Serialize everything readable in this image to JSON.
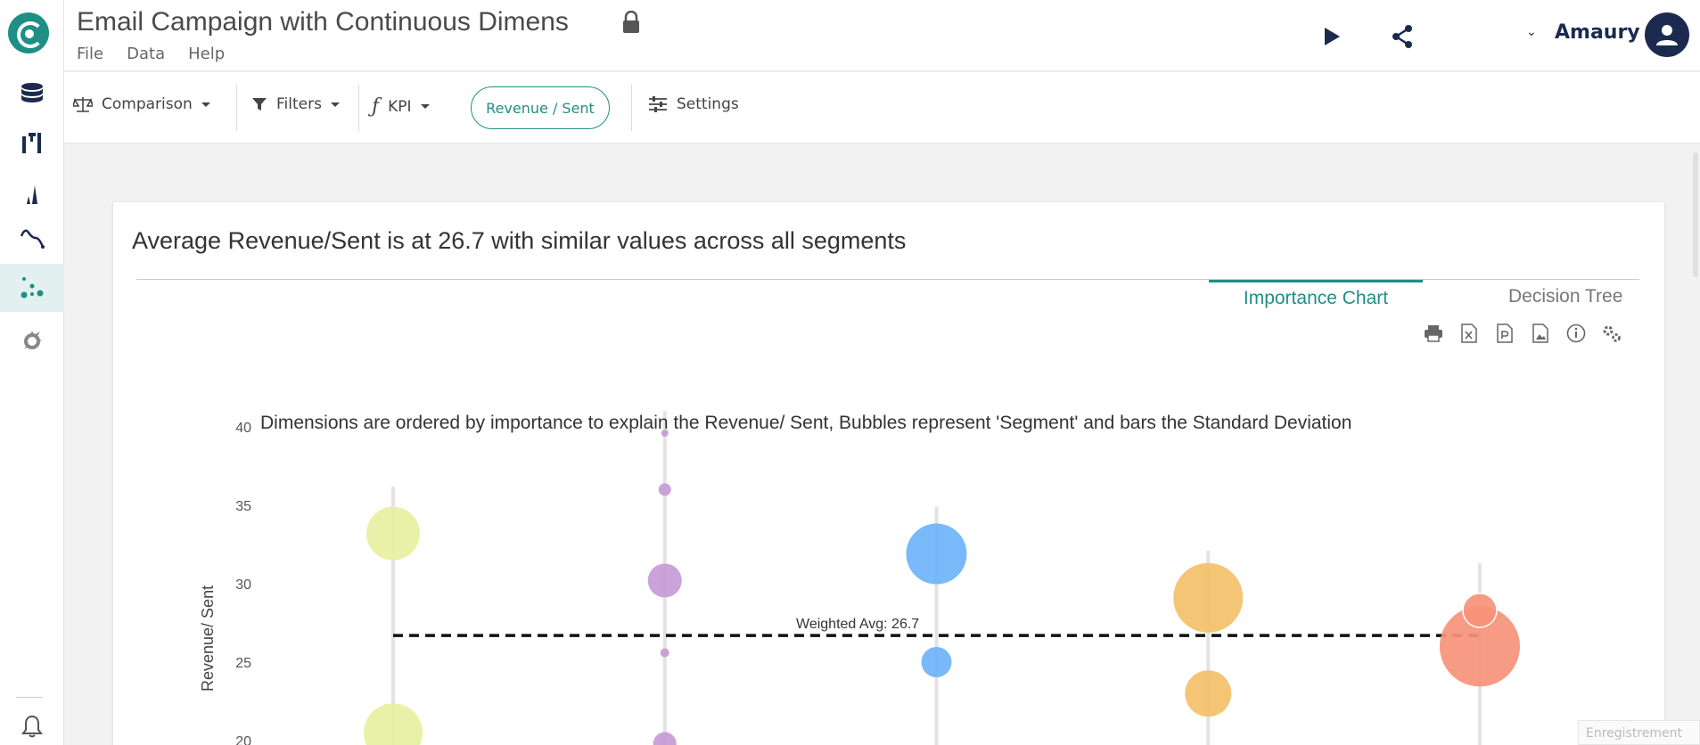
{
  "app": {
    "title": "Email Campaign with Continuous Dimens",
    "menu": [
      "File",
      "Data",
      "Help"
    ],
    "user": "Amaury"
  },
  "rail": {
    "items": [
      "database-icon",
      "columns-icon",
      "distribution-icon",
      "trend-icon",
      "segments-icon",
      "settings-cog-icon"
    ],
    "active": "segments-icon",
    "bottom": "bell-icon"
  },
  "toolbar": {
    "comparison": "Comparison",
    "filters": "Filters",
    "kpi": "KPI",
    "kpi_value": "Revenue / Sent",
    "settings": "Settings"
  },
  "card": {
    "headline": "Average Revenue/Sent is at 26.7 with similar values across all segments",
    "tabs": [
      "Importance Chart",
      "Decision Tree"
    ],
    "active_tab": "Importance Chart",
    "tools": [
      "print-icon",
      "excel-icon",
      "powerpoint-icon",
      "image-icon",
      "info-icon",
      "gears-icon"
    ]
  },
  "chart_data": {
    "type": "scatter",
    "title": "Dimensions are ordered by importance to explain the Revenue/ Sent, Bubbles represent 'Segment' and bars the Standard Deviation",
    "ylabel": "Revenue/ Sent",
    "ylim": [
      20,
      40
    ],
    "yticks": [
      20,
      25,
      30,
      35,
      40
    ],
    "reference_line": {
      "label": "Weighted Avg: 26.7",
      "value": 26.7,
      "style": "dashed"
    },
    "series": [
      {
        "color": "#e6f0a0",
        "points": [
          {
            "x": 1,
            "y": 33.2,
            "size": 30
          },
          {
            "x": 1,
            "y": 20.5,
            "size": 33
          }
        ]
      },
      {
        "color": "#c79ad6",
        "points": [
          {
            "x": 2,
            "y": 39.6,
            "size": 4
          },
          {
            "x": 2,
            "y": 36.0,
            "size": 7
          },
          {
            "x": 2,
            "y": 30.2,
            "size": 19
          },
          {
            "x": 2,
            "y": 25.6,
            "size": 5
          },
          {
            "x": 2,
            "y": 19.8,
            "size": 13
          }
        ]
      },
      {
        "color": "#6eb3f8",
        "points": [
          {
            "x": 3,
            "y": 31.9,
            "size": 34
          },
          {
            "x": 3,
            "y": 25.0,
            "size": 17
          }
        ]
      },
      {
        "color": "#f3c069",
        "points": [
          {
            "x": 4,
            "y": 29.1,
            "size": 39
          },
          {
            "x": 4,
            "y": 23.0,
            "size": 26
          }
        ]
      },
      {
        "color": "#f7937a",
        "points": [
          {
            "x": 5,
            "y": 26.0,
            "size": 45
          },
          {
            "x": 5,
            "y": 28.3,
            "size": 19
          }
        ]
      }
    ]
  },
  "footer": {
    "watermark": "Enregistrement"
  }
}
